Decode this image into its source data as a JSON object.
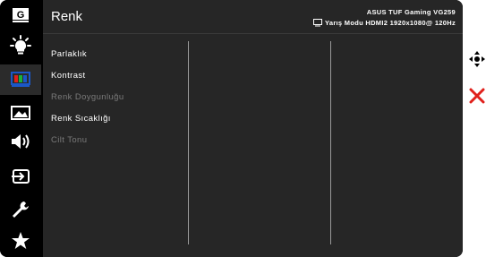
{
  "sidebar": {
    "items": [
      {
        "icon": "gamevisual-icon",
        "active": false
      },
      {
        "icon": "blue-light-filter-icon",
        "active": false
      },
      {
        "icon": "color-icon",
        "active": true
      },
      {
        "icon": "image-icon",
        "active": false
      },
      {
        "icon": "sound-icon",
        "active": false
      },
      {
        "icon": "input-select-icon",
        "active": false
      },
      {
        "icon": "system-setup-icon",
        "active": false
      },
      {
        "icon": "shortcut-icon",
        "active": false
      }
    ],
    "gamevisual_glyph": "G"
  },
  "header": {
    "title": "Renk",
    "model": "ASUS TUF Gaming  VG259",
    "status": "Yarış Modu HDMI2 1920x1080@ 120Hz"
  },
  "menu": {
    "items": [
      {
        "label": "Parlaklık",
        "enabled": true
      },
      {
        "label": "Kontrast",
        "enabled": true
      },
      {
        "label": "Renk Doygunluğu",
        "enabled": false
      },
      {
        "label": "Renk Sıcaklığı",
        "enabled": true
      },
      {
        "label": "Cilt Tonu",
        "enabled": false
      }
    ]
  },
  "nav_keys": [
    {
      "icon": "navigate-icon",
      "color": "#ffffff"
    },
    {
      "icon": "close-icon",
      "color": "#e0201b"
    }
  ],
  "colors": {
    "panel": "#262626",
    "sidebar": "#000000",
    "accent_red": "#e0201b",
    "color_icon_blue": "#1b57c8"
  }
}
